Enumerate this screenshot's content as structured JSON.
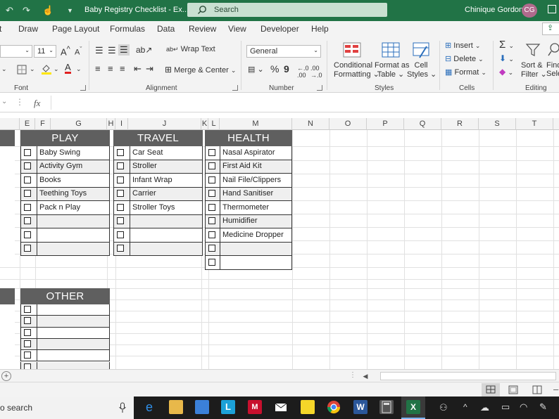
{
  "titlebar": {
    "doc_title": "Baby Registry Checklist  -  Ex...",
    "search_placeholder": "Search",
    "user_name": "Chinique Gordon",
    "user_initials": "CG"
  },
  "tabs": [
    "Draw",
    "Page Layout",
    "Formulas",
    "Data",
    "Review",
    "View",
    "Developer",
    "Help"
  ],
  "ribbon": {
    "font": {
      "size": "11",
      "label": "Font"
    },
    "alignment": {
      "wrap_text": "Wrap Text",
      "merge_center": "Merge & Center",
      "label": "Alignment"
    },
    "number": {
      "format": "General",
      "label": "Number"
    },
    "styles": {
      "conditional_1": "Conditional",
      "conditional_2": "Formatting",
      "format_table_1": "Format as",
      "format_table_2": "Table",
      "cell_styles_1": "Cell",
      "cell_styles_2": "Styles",
      "label": "Styles"
    },
    "cells": {
      "insert": "Insert",
      "delete": "Delete",
      "format": "Format",
      "label": "Cells"
    },
    "editing": {
      "sort_1": "Sort &",
      "sort_2": "Filter",
      "find_1": "Find",
      "find_2": "Selec",
      "label": "Editing"
    }
  },
  "formula_bar": {
    "fx": "fx"
  },
  "columns": [
    "E",
    "F",
    "G",
    "H",
    "I",
    "J",
    "K",
    "L",
    "M",
    "N",
    "O",
    "P",
    "Q",
    "R",
    "S",
    "T"
  ],
  "panels": {
    "play": {
      "title": "PLAY",
      "items": [
        "Baby Swing",
        "Activity Gym",
        "Books",
        "Teething Toys",
        "Pack n Play",
        "",
        "",
        ""
      ]
    },
    "travel": {
      "title": "TRAVEL",
      "items": [
        "Car Seat",
        "Stroller",
        "Infant Wrap",
        "Carrier",
        "Stroller Toys",
        "",
        "",
        ""
      ]
    },
    "health": {
      "title": "HEALTH",
      "items": [
        "Nasal Aspirator",
        "First Aid Kit",
        "Nail File/Clippers",
        "Hand Sanitiser",
        "Thermometer",
        "Humidifier",
        "Medicine Dropper",
        "",
        ""
      ]
    },
    "other": {
      "title": "OTHER",
      "items": [
        "",
        "",
        "",
        "",
        "",
        ""
      ]
    }
  },
  "taskbar": {
    "search_text": "o search"
  },
  "colors": {
    "excel_green": "#217346",
    "panel_header": "#5f5f5f",
    "alt_row": "#efefef"
  }
}
